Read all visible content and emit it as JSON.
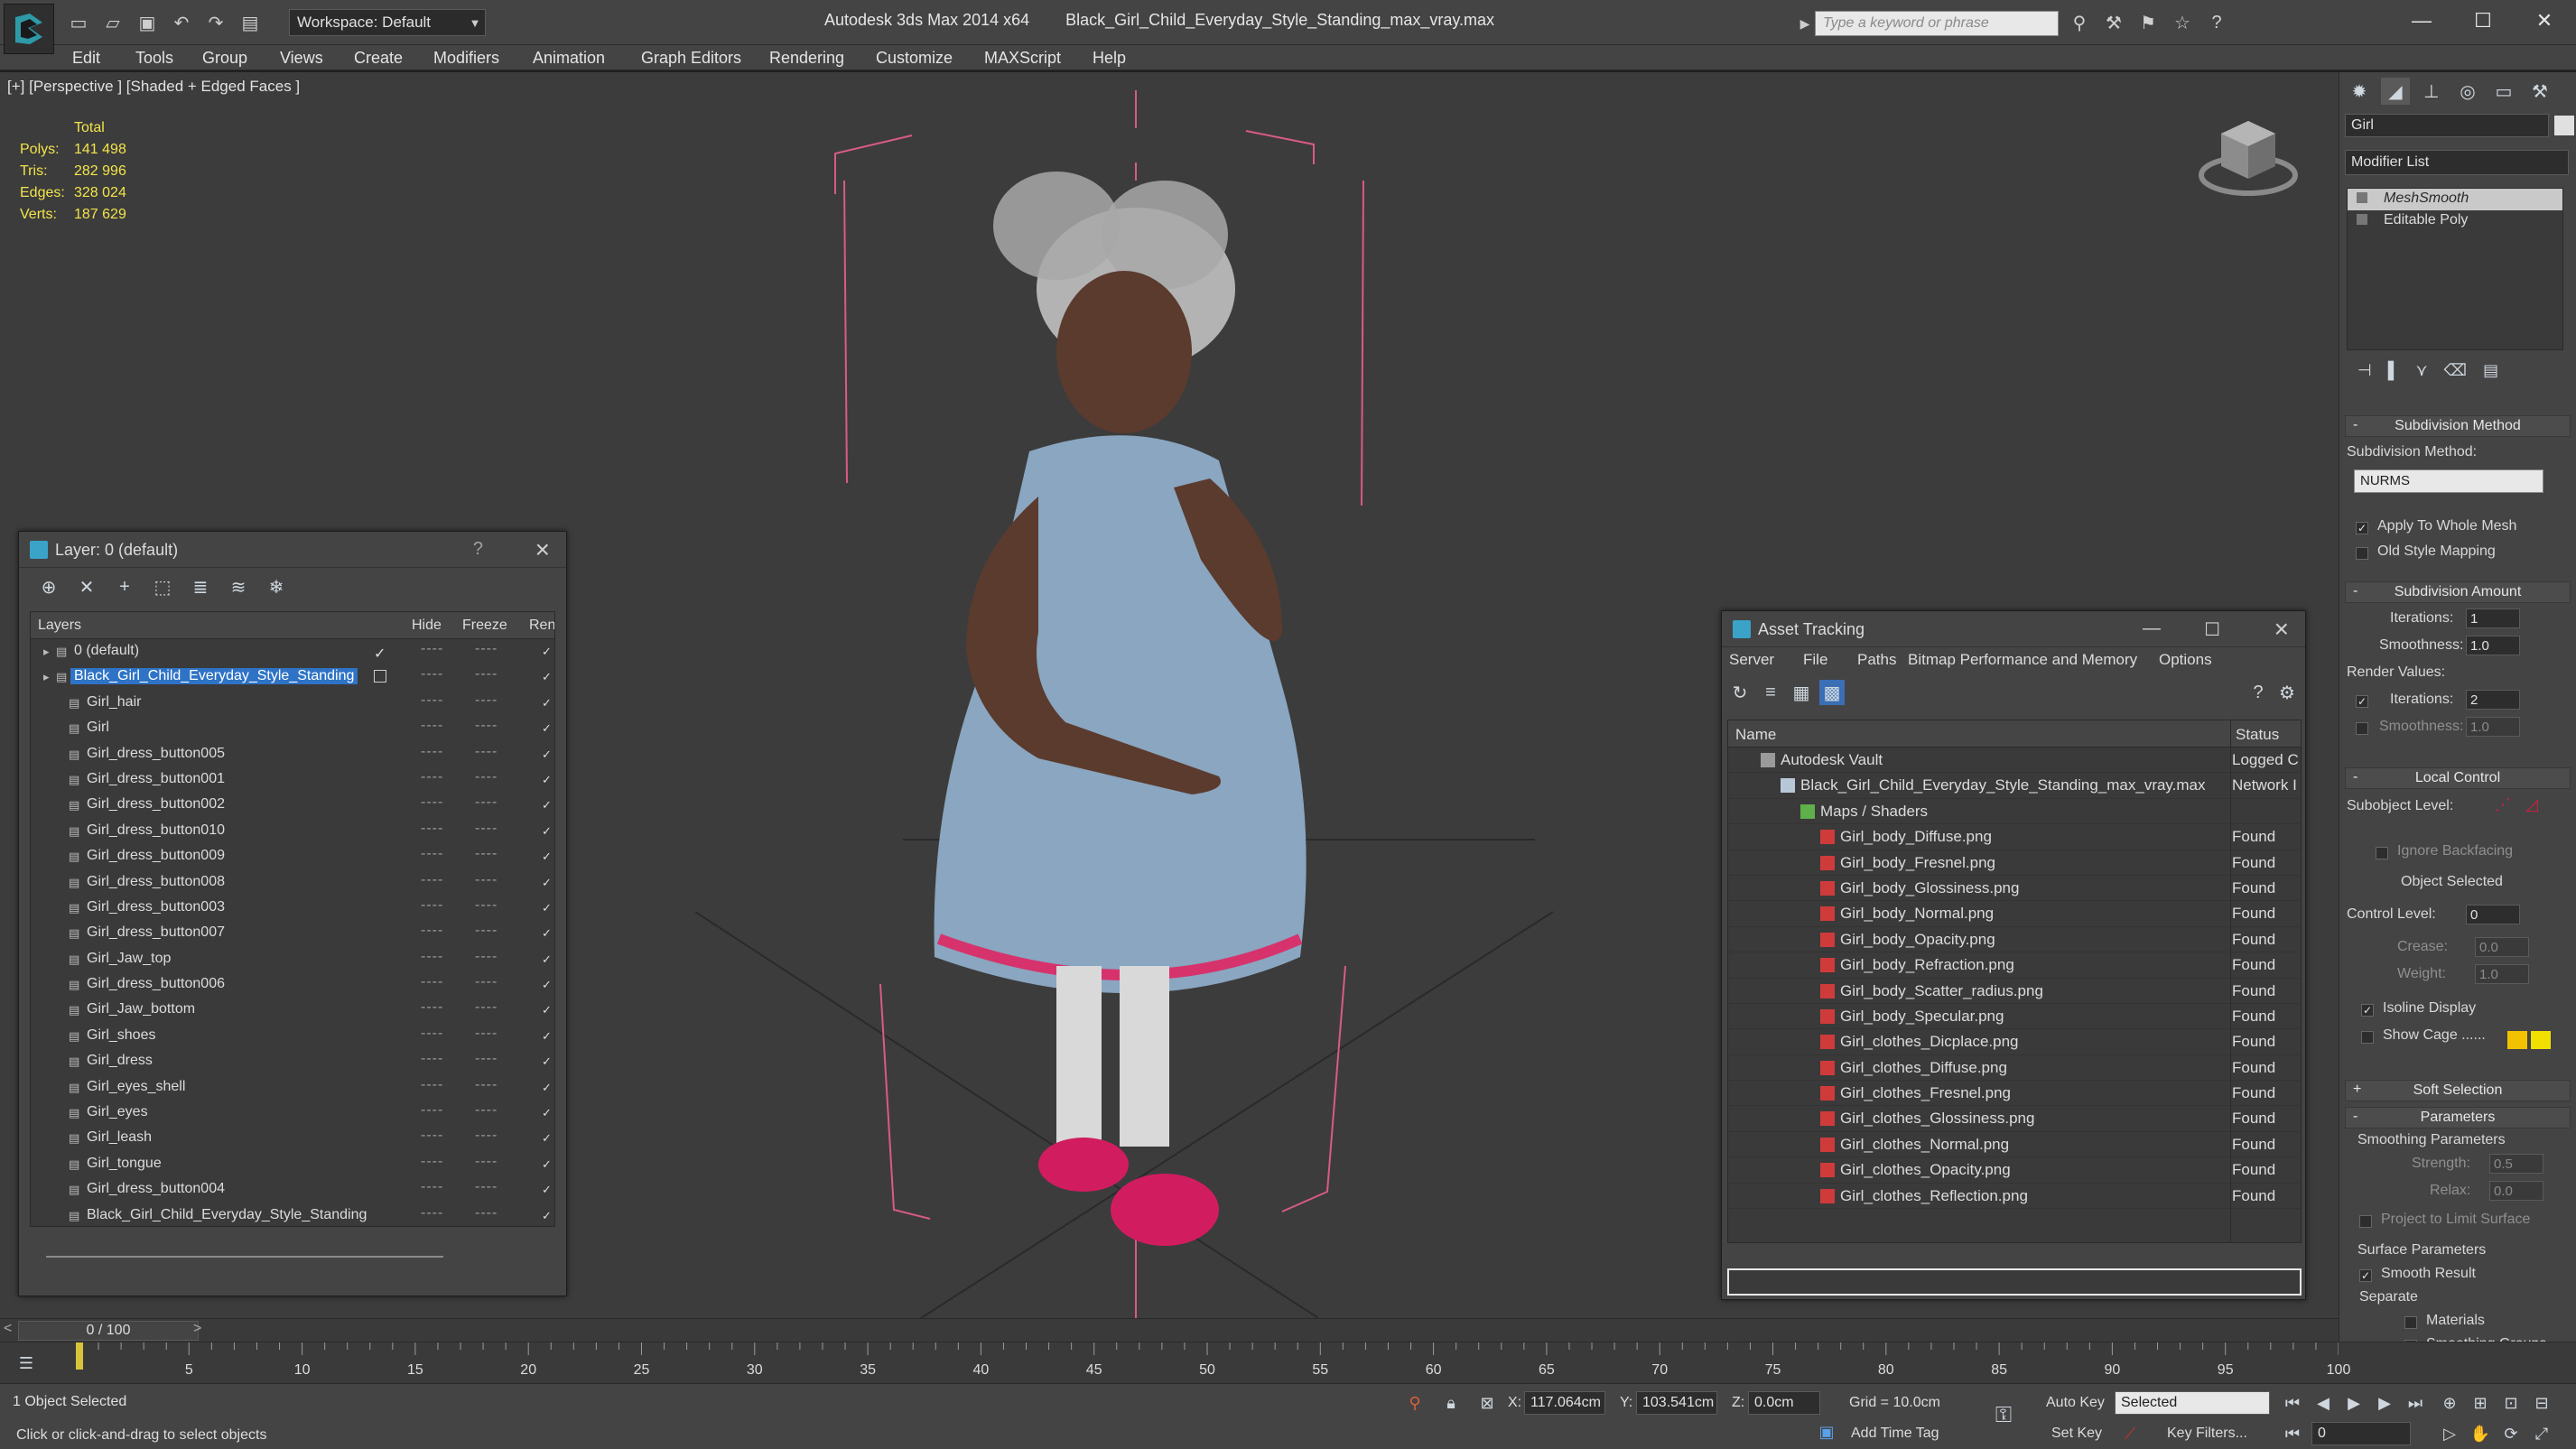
{
  "titlebar": {
    "workspace_label": "Workspace: Default",
    "app_name": "Autodesk 3ds Max  2014 x64",
    "file_name": "Black_Girl_Child_Everyday_Style_Standing_max_vray.max",
    "search_placeholder": "Type a keyword or phrase"
  },
  "menu": [
    "Edit",
    "Tools",
    "Group",
    "Views",
    "Create",
    "Modifiers",
    "Animation",
    "Graph Editors",
    "Rendering",
    "Customize",
    "MAXScript",
    "Help"
  ],
  "viewport": {
    "label": "[+] [Perspective ] [Shaded + Edged Faces ]",
    "stats": {
      "header": "Total",
      "rows": [
        {
          "k": "Polys:",
          "v": "141 498"
        },
        {
          "k": "Tris:",
          "v": "282 996"
        },
        {
          "k": "Edges:",
          "v": "328 024"
        },
        {
          "k": "Verts:",
          "v": "187 629"
        }
      ]
    }
  },
  "layer_panel": {
    "title": "Layer: 0 (default)",
    "help": "?",
    "columns": {
      "layers": "Layers",
      "hide": "Hide",
      "freeze": "Freeze",
      "render": "Ren"
    },
    "rows": [
      {
        "name": "0 (default)",
        "indent": 0,
        "check": true
      },
      {
        "name": "Black_Girl_Child_Everyday_Style_Standing",
        "indent": 0,
        "selected": true
      },
      {
        "name": "Girl_hair",
        "indent": 1
      },
      {
        "name": "Girl",
        "indent": 1
      },
      {
        "name": "Girl_dress_button005",
        "indent": 1
      },
      {
        "name": "Girl_dress_button001",
        "indent": 1
      },
      {
        "name": "Girl_dress_button002",
        "indent": 1
      },
      {
        "name": "Girl_dress_button010",
        "indent": 1
      },
      {
        "name": "Girl_dress_button009",
        "indent": 1
      },
      {
        "name": "Girl_dress_button008",
        "indent": 1
      },
      {
        "name": "Girl_dress_button003",
        "indent": 1
      },
      {
        "name": "Girl_dress_button007",
        "indent": 1
      },
      {
        "name": "Girl_Jaw_top",
        "indent": 1
      },
      {
        "name": "Girl_dress_button006",
        "indent": 1
      },
      {
        "name": "Girl_Jaw_bottom",
        "indent": 1
      },
      {
        "name": "Girl_shoes",
        "indent": 1
      },
      {
        "name": "Girl_dress",
        "indent": 1
      },
      {
        "name": "Girl_eyes_shell",
        "indent": 1
      },
      {
        "name": "Girl_eyes",
        "indent": 1
      },
      {
        "name": "Girl_leash",
        "indent": 1
      },
      {
        "name": "Girl_tongue",
        "indent": 1
      },
      {
        "name": "Girl_dress_button004",
        "indent": 1
      },
      {
        "name": "Black_Girl_Child_Everyday_Style_Standing",
        "indent": 1
      }
    ]
  },
  "asset_panel": {
    "title": "Asset Tracking",
    "menu": [
      "Server",
      "File",
      "Paths",
      "Bitmap Performance and Memory",
      "Options"
    ],
    "columns": {
      "name": "Name",
      "status": "Status"
    },
    "rows": [
      {
        "name": "Autodesk Vault",
        "status": "Logged C",
        "level": 0,
        "kind": "vault"
      },
      {
        "name": "Black_Girl_Child_Everyday_Style_Standing_max_vray.max",
        "status": "Network I",
        "level": 1,
        "kind": "file"
      },
      {
        "name": "Maps / Shaders",
        "status": "",
        "level": 2,
        "kind": "maps"
      },
      {
        "name": "Girl_body_Diffuse.png",
        "status": "Found",
        "level": 3,
        "kind": "png"
      },
      {
        "name": "Girl_body_Fresnel.png",
        "status": "Found",
        "level": 3,
        "kind": "png"
      },
      {
        "name": "Girl_body_Glossiness.png",
        "status": "Found",
        "level": 3,
        "kind": "png"
      },
      {
        "name": "Girl_body_Normal.png",
        "status": "Found",
        "level": 3,
        "kind": "png"
      },
      {
        "name": "Girl_body_Opacity.png",
        "status": "Found",
        "level": 3,
        "kind": "png"
      },
      {
        "name": "Girl_body_Refraction.png",
        "status": "Found",
        "level": 3,
        "kind": "png"
      },
      {
        "name": "Girl_body_Scatter_radius.png",
        "status": "Found",
        "level": 3,
        "kind": "png"
      },
      {
        "name": "Girl_body_Specular.png",
        "status": "Found",
        "level": 3,
        "kind": "png"
      },
      {
        "name": "Girl_clothes_Dicplace.png",
        "status": "Found",
        "level": 3,
        "kind": "png"
      },
      {
        "name": "Girl_clothes_Diffuse.png",
        "status": "Found",
        "level": 3,
        "kind": "png"
      },
      {
        "name": "Girl_clothes_Fresnel.png",
        "status": "Found",
        "level": 3,
        "kind": "png"
      },
      {
        "name": "Girl_clothes_Glossiness.png",
        "status": "Found",
        "level": 3,
        "kind": "png"
      },
      {
        "name": "Girl_clothes_Normal.png",
        "status": "Found",
        "level": 3,
        "kind": "png"
      },
      {
        "name": "Girl_clothes_Opacity.png",
        "status": "Found",
        "level": 3,
        "kind": "png"
      },
      {
        "name": "Girl_clothes_Reflection.png",
        "status": "Found",
        "level": 3,
        "kind": "png"
      }
    ]
  },
  "command_panel": {
    "object_name": "Girl",
    "modifier_list": "Modifier List",
    "stack": [
      {
        "name": "MeshSmooth",
        "selected": true
      },
      {
        "name": "Editable Poly",
        "selected": false
      }
    ],
    "subdivision_method": {
      "title": "Subdivision Method",
      "label": "Subdivision Method:",
      "value": "NURMS",
      "apply_whole_mesh": "Apply To Whole Mesh",
      "old_style": "Old Style Mapping"
    },
    "subdivision_amount": {
      "title": "Subdivision Amount",
      "iterations_label": "Iterations:",
      "iterations": "1",
      "smoothness_label": "Smoothness:",
      "smoothness": "1.0",
      "render_values": "Render Values:",
      "r_iterations_label": "Iterations:",
      "r_iterations": "2",
      "r_smoothness_label": "Smoothness:",
      "r_smoothness": "1.0"
    },
    "local_control": {
      "title": "Local Control",
      "subobject_level": "Subobject Level:",
      "ignore_backfacing": "Ignore Backfacing",
      "object_selected": "Object Selected",
      "control_level_label": "Control Level:",
      "control_level": "0",
      "crease_label": "Crease:",
      "crease": "0.0",
      "weight_label": "Weight:",
      "weight": "1.0",
      "isoline_display": "Isoline Display",
      "show_cage": "Show Cage ......"
    },
    "soft_selection": {
      "title": "Soft Selection"
    },
    "parameters": {
      "title": "Parameters",
      "smoothing_params": "Smoothing Parameters",
      "strength_label": "Strength:",
      "strength": "0.5",
      "relax_label": "Relax:",
      "relax": "0.0",
      "project_limit": "Project to Limit Surface",
      "surface_params": "Surface Parameters",
      "smooth_result": "Smooth Result",
      "separate": "Separate",
      "materials": "Materials",
      "smoothing_groups": "Smoothing Groups"
    },
    "colors": {
      "cage1": "#f2c200",
      "cage2": "#f2e000"
    }
  },
  "timeline": {
    "slider": "0 / 100",
    "ticks": [
      "5",
      "10",
      "15",
      "20",
      "25",
      "30",
      "35",
      "40",
      "45",
      "50",
      "55",
      "60",
      "65",
      "70",
      "75",
      "80",
      "85",
      "90",
      "95",
      "100"
    ]
  },
  "status": {
    "selected": "1 Object Selected",
    "prompt": "Click or click-and-drag to select objects",
    "x_label": "X:",
    "x": "117.064cm",
    "y_label": "Y:",
    "y": "103.541cm",
    "z_label": "Z:",
    "z": "0.0cm",
    "grid": "Grid = 10.0cm",
    "add_time_tag": "Add Time Tag",
    "auto_key": "Auto Key",
    "set_key": "Set Key",
    "selected_mode": "Selected",
    "key_filters": "Key Filters...",
    "frame": "0"
  }
}
